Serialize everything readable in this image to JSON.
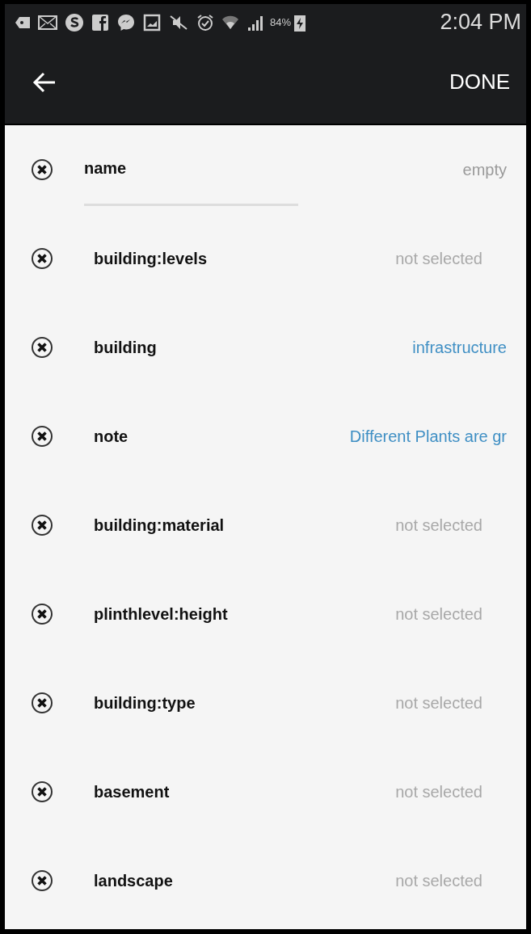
{
  "status_bar": {
    "battery": "84%",
    "time": "2:04 PM"
  },
  "app_bar": {
    "action": "DONE"
  },
  "tags": [
    {
      "key": "name",
      "kind": "text",
      "placeholder": "empty"
    },
    {
      "key": "building:levels",
      "kind": "select",
      "value": "not selected",
      "set": false
    },
    {
      "key": "building",
      "kind": "select",
      "value": "infrastructure",
      "set": true
    },
    {
      "key": "note",
      "kind": "select",
      "value": "Different Plants are gr",
      "set": true
    },
    {
      "key": "building:material",
      "kind": "select",
      "value": "not selected",
      "set": false
    },
    {
      "key": "plinthlevel:height",
      "kind": "select",
      "value": "not selected",
      "set": false
    },
    {
      "key": "building:type",
      "kind": "select",
      "value": "not selected",
      "set": false
    },
    {
      "key": "basement",
      "kind": "select",
      "value": "not selected",
      "set": false
    },
    {
      "key": "landscape",
      "kind": "select",
      "value": "not selected",
      "set": false
    }
  ]
}
